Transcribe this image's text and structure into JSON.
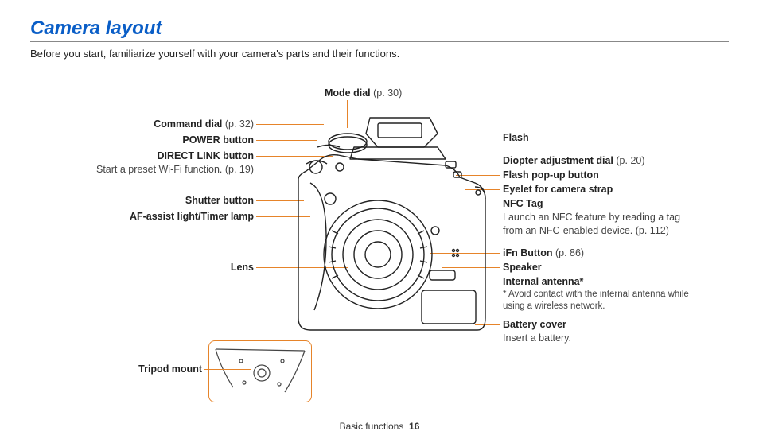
{
  "title": "Camera layout",
  "intro": "Before you start, familiarize yourself with your camera's parts and their functions.",
  "center_top": {
    "mode_dial": "Mode dial",
    "mode_dial_ref": "(p. 30)"
  },
  "left": {
    "command_dial": "Command dial",
    "command_dial_ref": "(p. 32)",
    "power_button": "POWER button",
    "direct_link": "DIRECT LINK button",
    "direct_link_desc": "Start a preset Wi-Fi function. (p. 19)",
    "shutter": "Shutter button",
    "af_assist": "AF-assist light/Timer lamp",
    "lens": "Lens",
    "tripod": "Tripod mount"
  },
  "right": {
    "flash": "Flash",
    "diopter": "Diopter adjustment dial",
    "diopter_ref": "(p. 20)",
    "flash_popup": "Flash pop-up button",
    "eyelet": "Eyelet for camera strap",
    "nfc": "NFC Tag",
    "nfc_desc": "Launch an NFC feature by reading a tag from an NFC-enabled device. (p. 112)",
    "ifn": "iFn Button",
    "ifn_ref": "(p. 86)",
    "speaker": "Speaker",
    "antenna": "Internal antenna*",
    "antenna_note": "* Avoid contact with the internal antenna while using a wireless network.",
    "battery": "Battery cover",
    "battery_desc": "Insert a battery."
  },
  "footer": {
    "section": "Basic functions",
    "page": "16"
  }
}
